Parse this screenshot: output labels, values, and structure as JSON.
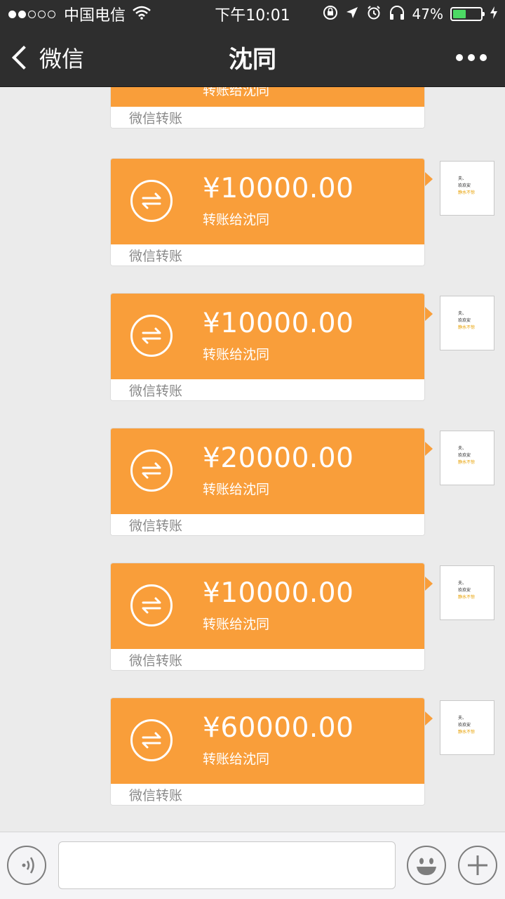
{
  "status_bar": {
    "carrier": "中国电信",
    "time": "下午10:01",
    "battery_percent": "47%",
    "battery_level": 0.47,
    "signal_strength": 2,
    "signal_total": 5
  },
  "nav": {
    "back_label": "微信",
    "title": "沈同"
  },
  "messages": [
    {
      "amount": "",
      "desc": "转账给沈同",
      "footer": "微信转账"
    },
    {
      "amount": "¥10000.00",
      "desc": "转账给沈同",
      "footer": "微信转账"
    },
    {
      "amount": "¥10000.00",
      "desc": "转账给沈同",
      "footer": "微信转账"
    },
    {
      "amount": "¥20000.00",
      "desc": "转账给沈同",
      "footer": "微信转账"
    },
    {
      "amount": "¥10000.00",
      "desc": "转账给沈同",
      "footer": "微信转账"
    },
    {
      "amount": "¥60000.00",
      "desc": "转账给沈同",
      "footer": "微信转账"
    }
  ],
  "avatar": {
    "line1": "夫、",
    "line2": "玖玖安",
    "line3": "静水不惊"
  },
  "input": {
    "value": "",
    "placeholder": ""
  },
  "colors": {
    "transfer_orange": "#f99e3a",
    "bar_dark": "#2e2e2e",
    "chat_bg": "#ebebeb",
    "battery_green": "#4cd964"
  },
  "icons": [
    "back-chevron",
    "more-dots",
    "transfer-arrows",
    "voice",
    "emoji",
    "plus",
    "wifi",
    "battery"
  ]
}
